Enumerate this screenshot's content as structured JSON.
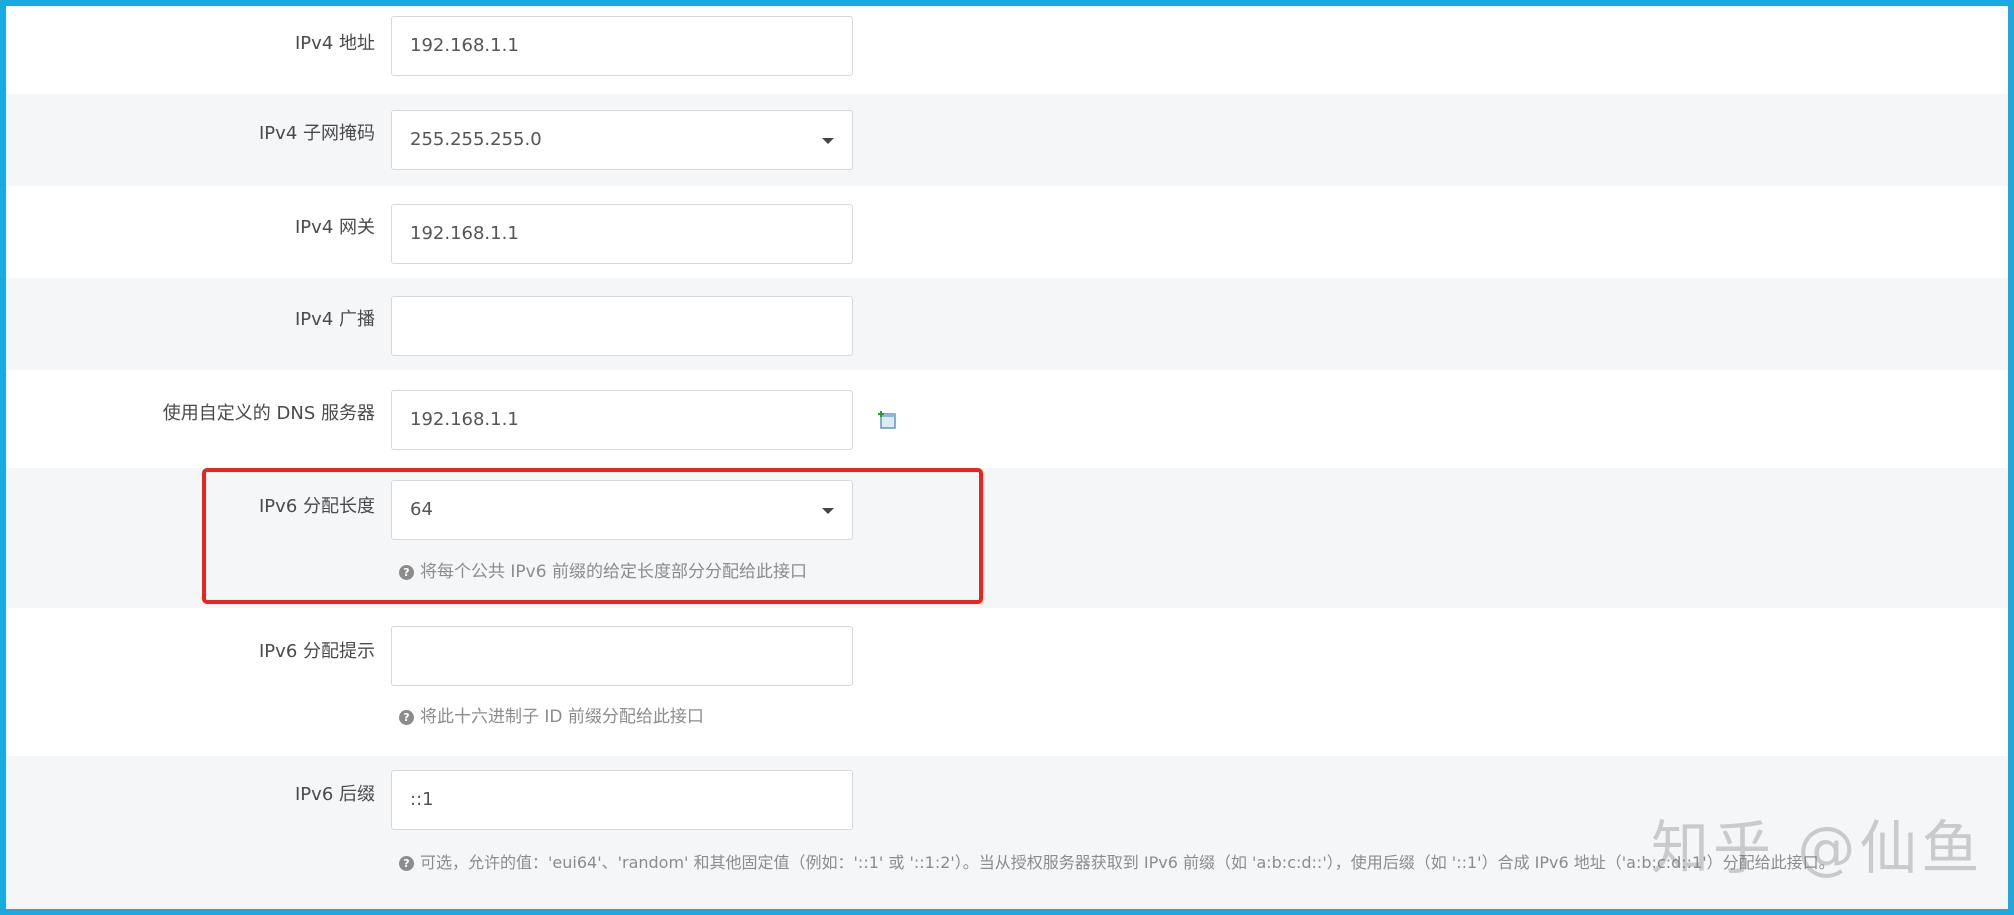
{
  "rows": [
    {
      "label": "IPv4 地址",
      "value": "192.168.1.1",
      "type": "text"
    },
    {
      "label": "IPv4 子网掩码",
      "value": "255.255.255.0",
      "type": "select"
    },
    {
      "label": "IPv4 网关",
      "value": "192.168.1.1",
      "type": "text"
    },
    {
      "label": "IPv4 广播",
      "value": "",
      "type": "text"
    },
    {
      "label": "使用自定义的 DNS 服务器",
      "value": "192.168.1.1",
      "type": "text",
      "action_icon": "add-entry-icon"
    },
    {
      "label": "IPv6 分配长度",
      "value": "64",
      "type": "select",
      "hint": "将每个公共 IPv6 前缀的给定长度部分分配给此接口"
    },
    {
      "label": "IPv6 分配提示",
      "value": "",
      "type": "text",
      "hint": "将此十六进制子 ID 前缀分配给此接口"
    },
    {
      "label": "IPv6 后缀",
      "value": "::1",
      "type": "text",
      "hint": "可选，允许的值：'eui64'、'random' 和其他固定值（例如：'::1' 或 '::1:2'）。当从授权服务器获取到 IPv6 前缀（如 'a:b:c:d::'），使用后缀（如 '::1'）合成 IPv6 地址（'a:b:c:d::1'）分配给此接口。"
    }
  ],
  "hint_icon": "help-circle-icon",
  "watermark": "知乎 @仙鱼",
  "colors": {
    "frame": "#1ba9e0",
    "highlight": "#e8261f",
    "row_alt": "#f5f6f8"
  }
}
